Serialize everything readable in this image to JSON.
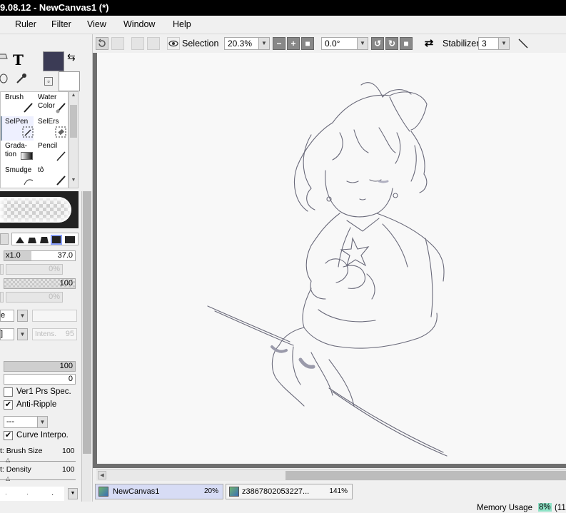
{
  "title": "9.08.12 - NewCanvas1 (*)",
  "menu": [
    "Ruler",
    "Filter",
    "View",
    "Window",
    "Help"
  ],
  "toolbar": {
    "selection_label": "Selection",
    "zoom": "20.3%",
    "rotation": "0.0°",
    "stabilizer_label": "Stabilizer",
    "stabilizer_value": "3"
  },
  "tools": [
    {
      "name": "Brush",
      "icon": "brush-icon"
    },
    {
      "name": "Water Color",
      "icon": "watercolor-icon"
    },
    {
      "name": "SelPen",
      "icon": "selpen-icon"
    },
    {
      "name": "SelErs",
      "icon": "selers-icon"
    },
    {
      "name": "Grada- tion",
      "icon": "gradation-icon"
    },
    {
      "name": "Pencil",
      "icon": "pencil-icon"
    },
    {
      "name": "Smudge",
      "icon": "smudge-icon"
    },
    {
      "name": "tô",
      "icon": "custom-brush-icon"
    }
  ],
  "brush": {
    "size_mult": "x1.0",
    "size": "37.0",
    "min_size": "0%",
    "density": "100",
    "min_density": "0%",
    "intensity_placeholder": "Intens.",
    "intensity_value": "95",
    "blend_value": "100",
    "persistence_value": "0",
    "ver1_label": "Ver1 Prs Spec.",
    "anti_ripple_label": "Anti-Ripple",
    "select_value": "---",
    "curve_interpo_label": "Curve Interpo.",
    "press_brush_size_label": "t: Brush Size",
    "press_brush_size_value": "100",
    "press_density_label": "t: Density",
    "press_density_value": "100"
  },
  "tabs": [
    {
      "name": "NewCanvas1",
      "zoom": "20%"
    },
    {
      "name": "z3867802053227...",
      "zoom": "141%"
    }
  ],
  "status": {
    "memory_label": "Memory Usage",
    "memory_value": "8%",
    "memory_extra": "(11"
  },
  "colors": {
    "main_color": "#3b3b55",
    "active_tab": "#d7dcf5"
  }
}
